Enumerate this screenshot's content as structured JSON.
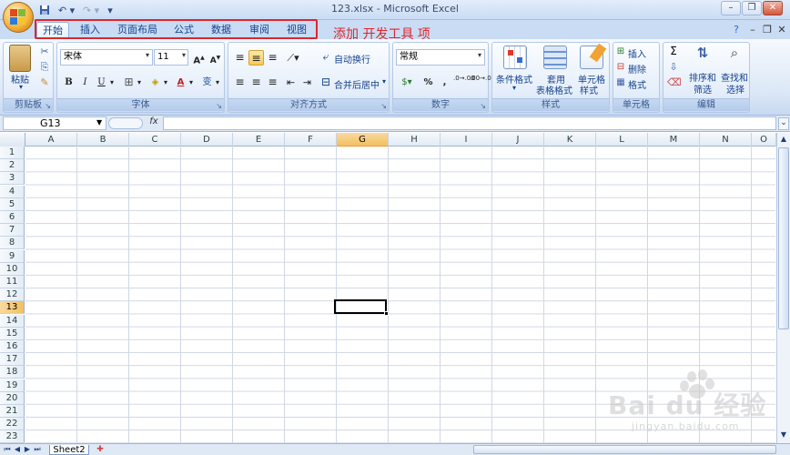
{
  "window": {
    "title": "123.xlsx - Microsoft Excel"
  },
  "quick_access": {
    "save_icon": "save-icon",
    "undo_icon": "undo-icon",
    "redo_icon": "redo-icon",
    "customize": "▾"
  },
  "tabs": [
    {
      "label": "开始",
      "active": true
    },
    {
      "label": "插入"
    },
    {
      "label": "页面布局"
    },
    {
      "label": "公式"
    },
    {
      "label": "数据"
    },
    {
      "label": "审阅"
    },
    {
      "label": "视图"
    }
  ],
  "annotation": "添加  开发工具 项",
  "ribbon": {
    "clipboard": {
      "label": "剪贴板",
      "paste": "粘贴"
    },
    "font": {
      "label": "字体",
      "font_name": "宋体",
      "font_size": "11",
      "bold": "B",
      "italic": "I",
      "underline": "U",
      "wen": "变"
    },
    "alignment": {
      "label": "对齐方式",
      "wrap": "自动换行",
      "merge": "合并后居中"
    },
    "number": {
      "label": "数字",
      "format": "常规",
      "percent": "%",
      "comma": ",",
      "dec_inc": ".0→.00",
      "dec_dec": ".00→.0"
    },
    "styles": {
      "label": "样式",
      "conditional": "条件格式",
      "table_format_1": "套用",
      "table_format_2": "表格格式",
      "cell_styles_1": "单元格",
      "cell_styles_2": "样式"
    },
    "cells": {
      "label": "单元格",
      "insert": "插入",
      "delete": "删除",
      "format": "格式"
    },
    "editing": {
      "label": "编辑",
      "sort_1": "排序和",
      "sort_2": "筛选",
      "find_1": "查找和",
      "find_2": "选择"
    }
  },
  "formula_bar": {
    "name_box": "G13",
    "fx": "fx",
    "formula": ""
  },
  "columns": [
    "A",
    "B",
    "C",
    "D",
    "E",
    "F",
    "G",
    "H",
    "I",
    "J",
    "K",
    "L",
    "M",
    "N",
    "O"
  ],
  "rows": [
    "1",
    "2",
    "3",
    "4",
    "5",
    "6",
    "7",
    "8",
    "9",
    "10",
    "11",
    "12",
    "13",
    "14",
    "15",
    "16",
    "17",
    "18",
    "19",
    "20",
    "21",
    "22",
    "23"
  ],
  "selected": {
    "column": "G",
    "row": "13"
  },
  "sheets": [
    {
      "label": "Sheet2"
    }
  ],
  "watermark": {
    "text": "Bai du 经验",
    "url": "jingyan.baidu.com"
  },
  "colors": {
    "accent": "#e0262b",
    "selection": "#f1c15f",
    "ribbon": "#dce8f7"
  }
}
